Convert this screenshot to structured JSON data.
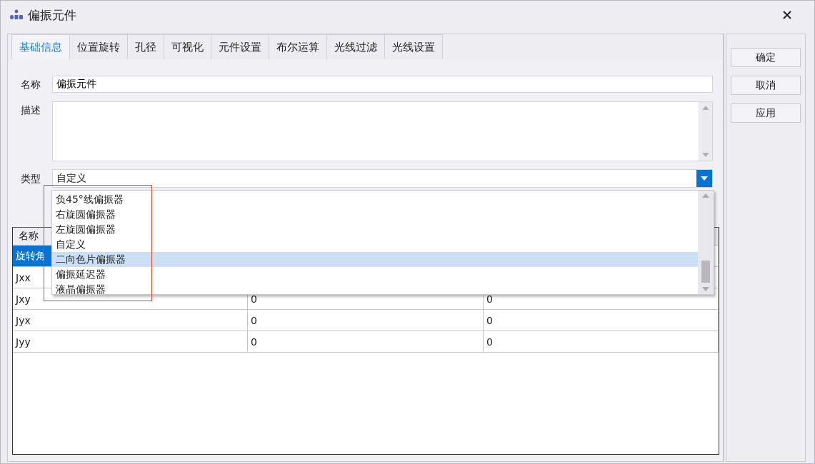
{
  "window": {
    "title": "偏振元件"
  },
  "tabs": [
    {
      "label": "基础信息",
      "selected": true
    },
    {
      "label": "位置旋转",
      "selected": false
    },
    {
      "label": "孔径",
      "selected": false
    },
    {
      "label": "可视化",
      "selected": false
    },
    {
      "label": "元件设置",
      "selected": false
    },
    {
      "label": "布尔运算",
      "selected": false
    },
    {
      "label": "光线过滤",
      "selected": false
    },
    {
      "label": "光线设置",
      "selected": false
    }
  ],
  "form": {
    "name_label": "名称",
    "name_value": "偏振元件",
    "description_label": "描述",
    "type_label": "类型",
    "type_value": "自定义"
  },
  "type_dropdown": {
    "expanded": true,
    "items": [
      {
        "label": "负45°线偏振器",
        "selected": false
      },
      {
        "label": "右旋圆偏振器",
        "selected": false
      },
      {
        "label": "左旋圆偏振器",
        "selected": false
      },
      {
        "label": "自定义",
        "selected": false
      },
      {
        "label": "二向色片偏振器",
        "selected": true
      },
      {
        "label": "偏振延迟器",
        "selected": false
      },
      {
        "label": "液晶偏振器",
        "selected": false
      }
    ]
  },
  "table": {
    "columns": [
      "名称"
    ],
    "rows": [
      {
        "cells": [
          "旋转角"
        ],
        "selected": true
      },
      {
        "cells": [
          "Jxx"
        ],
        "selected": false
      },
      {
        "cells": [
          "Jxy",
          "0",
          "0"
        ],
        "selected": false
      },
      {
        "cells": [
          "Jyx",
          "0",
          "0"
        ],
        "selected": false
      },
      {
        "cells": [
          "Jyy",
          "0",
          "0"
        ],
        "selected": false
      }
    ]
  },
  "buttons": [
    "确定",
    "取消",
    "应用"
  ]
}
